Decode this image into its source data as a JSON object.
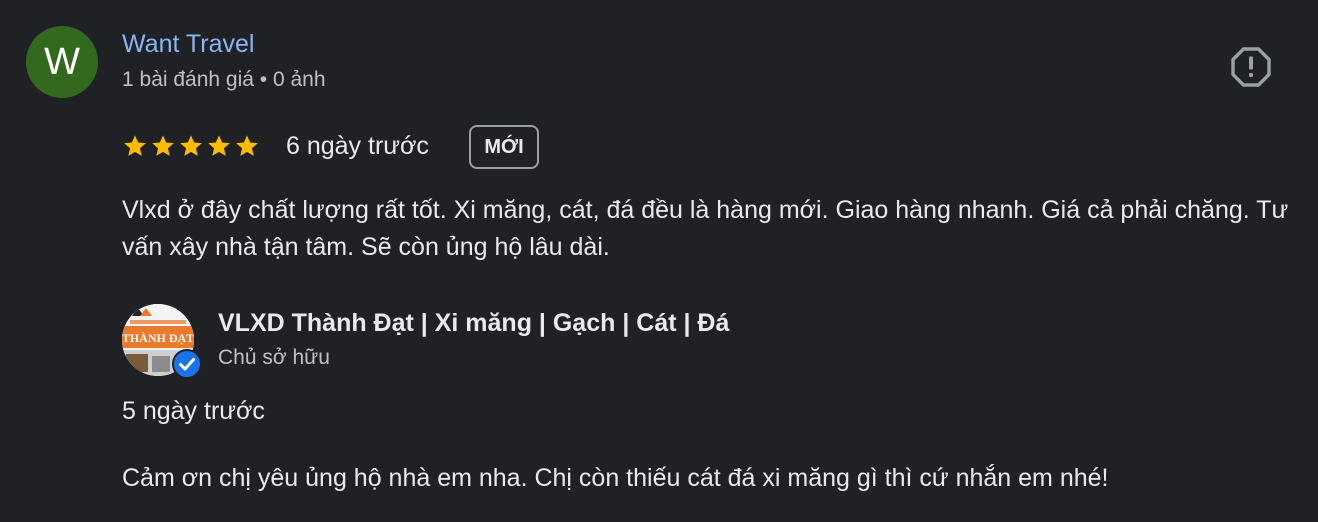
{
  "review": {
    "avatar_letter": "W",
    "avatar_color": "#33691e",
    "reviewer_name": "Want Travel",
    "reviewer_meta": "1 bài đánh giá • 0 ảnh",
    "rating": 5,
    "max_rating": 5,
    "time": "6 ngày trước",
    "badge": "MỚI",
    "text": "Vlxd ở đây chất lượng rất tốt. Xi măng, cát, đá đều là hàng mới. Giao hàng nhanh. Giá cả phải chăng. Tư vấn xây nhà tận tâm. Sẽ còn ủng hộ lâu dài.",
    "report_icon": "report-icon"
  },
  "owner_reply": {
    "logo_icon": "business-logo",
    "logo_text": "THÀNH ĐẠT",
    "verified_icon": "verified-badge-icon",
    "name": "VLXD Thành Đạt | Xi măng | Gạch | Cát | Đá",
    "role": "Chủ sở hữu",
    "time": "5 ngày trước",
    "text": "Cảm ơn chị yêu ủng hộ nhà em nha. Chị còn thiếu cát đá xi măng gì thì cứ nhắn em nhé!"
  },
  "colors": {
    "background": "#202124",
    "link": "#8ab4f8",
    "star": "#fbbc04",
    "verified": "#1a73e8"
  }
}
